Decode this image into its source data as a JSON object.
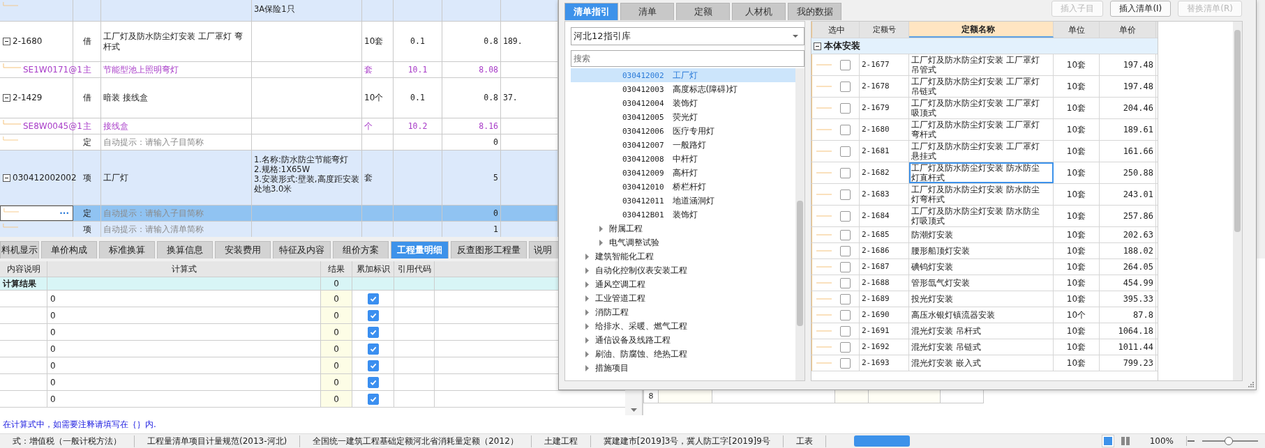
{
  "top_table": {
    "rows": [
      {
        "kind": "item",
        "selected": false,
        "features": "3A保险1只"
      },
      {
        "kind": "quota",
        "selected": false,
        "expanded": true,
        "code": "2-1680",
        "type": "借",
        "name": "工厂灯及防水防尘灯安装 工厂罩灯 弯杆式",
        "unit": "10套",
        "col_6": "0.1",
        "col_7": "0.8",
        "col_8": "189."
      },
      {
        "kind": "material",
        "selected": false,
        "code": "SE1W0171@1",
        "type": "主",
        "name": "节能型池上照明弯灯",
        "unit": "套",
        "col_6": "10.1",
        "col_7": "8.08"
      },
      {
        "kind": "quota",
        "selected": false,
        "expanded": true,
        "code": "2-1429",
        "type": "借",
        "name": "暗装 接线盒",
        "unit": "10个",
        "col_6": "0.1",
        "col_7": "0.8",
        "col_8": "37."
      },
      {
        "kind": "material",
        "selected": false,
        "code": "SE8W0045@1",
        "type": "主",
        "name": "接线盒",
        "unit": "个",
        "col_6": "10.2",
        "col_7": "8.16"
      },
      {
        "kind": "placeholder",
        "selected": false,
        "type": "定",
        "name": "自动提示：请输入子目简称",
        "col_7": "0"
      },
      {
        "kind": "item",
        "selected": false,
        "expanded": true,
        "code": "030412002002",
        "type": "项",
        "name": "工厂灯",
        "features": "1.名称:防水防尘节能弯灯\n2.规格:1X65W\n3.安装形式:壁装,高度距安装处地3.0米",
        "unit": "套",
        "col_7": "5"
      },
      {
        "kind": "placeholder",
        "selected": true,
        "edit_button": "···",
        "type": "定",
        "name": "自动提示：请输入子目简称",
        "col_7": "0"
      },
      {
        "kind": "item-placeholder",
        "selected": false,
        "type": "项",
        "name": "自动提示：请输入清单简称",
        "col_7": "1"
      }
    ]
  },
  "detail_tabs": [
    {
      "label": "料机显示",
      "selected": false
    },
    {
      "label": "单价构成",
      "selected": false
    },
    {
      "label": "标准换算",
      "selected": false
    },
    {
      "label": "换算信息",
      "selected": false
    },
    {
      "label": "安装费用",
      "selected": false
    },
    {
      "label": "特征及内容",
      "selected": false
    },
    {
      "label": "组价方案",
      "selected": false
    },
    {
      "label": "工程量明细",
      "selected": true
    },
    {
      "label": "反查图形工程量",
      "selected": false
    },
    {
      "label": "说明",
      "selected": false
    }
  ],
  "detail_table": {
    "columns": [
      "内容说明",
      "计算式",
      "结果",
      "累加标识",
      "引用代码"
    ],
    "total_row": {
      "label": "计算结果",
      "result": "0"
    },
    "rows": [
      {
        "formula": "0",
        "result": "0",
        "checked": true
      },
      {
        "formula": "0",
        "result": "0",
        "checked": true
      },
      {
        "formula": "0",
        "result": "0",
        "checked": true
      },
      {
        "formula": "0",
        "result": "0",
        "checked": true
      },
      {
        "formula": "0",
        "result": "0",
        "checked": true
      },
      {
        "formula": "0",
        "result": "0",
        "checked": true
      },
      {
        "formula": "0",
        "result": "0",
        "checked": true
      }
    ]
  },
  "side_table": {
    "row_number": "8"
  },
  "note": "在计算式中，如需要注释请填写在｛｝内.",
  "status_bar": {
    "items": [
      "式：增值税（一般计税方法）",
      "工程量清单项目计量规范(2013-河北)",
      "全国统一建筑工程基础定额河北省消耗量定额（2012）",
      "土建工程",
      "冀建建市[2019]3号，冀人防工字[2019]9号",
      "工表"
    ],
    "zoom": "100%",
    "zoom_slider": {
      "level": 0.45
    }
  },
  "dialog": {
    "tabs": [
      {
        "label": "清单指引",
        "selected": true
      },
      {
        "label": "清单",
        "selected": false
      },
      {
        "label": "定额",
        "selected": false
      },
      {
        "label": "人材机",
        "selected": false
      },
      {
        "label": "我的数据",
        "selected": false
      }
    ],
    "buttons": [
      {
        "label": "插入子目",
        "disabled": true
      },
      {
        "label": "插入清单(I)",
        "disabled": false
      },
      {
        "label": "替换清单(R)",
        "disabled": true
      }
    ],
    "library": "河北12指引库",
    "search": {
      "placeholder": "搜索"
    },
    "tree": [
      {
        "children": [
          {
            "children": [
              {
                "code": "030412002",
                "name": "工厂灯",
                "selected": true
              },
              {
                "code": "030412003",
                "name": "高度标志(障碍)灯",
                "selected": false
              },
              {
                "code": "030412004",
                "name": "装饰灯",
                "selected": false
              },
              {
                "code": "030412005",
                "name": "荧光灯",
                "selected": false
              },
              {
                "code": "030412006",
                "name": "医疗专用灯",
                "selected": false
              },
              {
                "code": "030412007",
                "name": "一般路灯",
                "selected": false
              },
              {
                "code": "030412008",
                "name": "中杆灯",
                "selected": false
              },
              {
                "code": "030412009",
                "name": "高杆灯",
                "selected": false
              },
              {
                "code": "030412010",
                "name": "桥栏杆灯",
                "selected": false
              },
              {
                "code": "030412011",
                "name": "地道涵洞灯",
                "selected": false
              },
              {
                "code": "030412B01",
                "name": "装饰灯",
                "selected": false
              }
            ]
          },
          {
            "label": "附属工程",
            "expanded": false
          },
          {
            "label": "电气调整试验",
            "expanded": false
          }
        ]
      },
      {
        "label": "建筑智能化工程",
        "expanded": false
      },
      {
        "label": "自动化控制仪表安装工程",
        "expanded": false
      },
      {
        "label": "通风空调工程",
        "expanded": false
      },
      {
        "label": "工业管道工程",
        "expanded": false
      },
      {
        "label": "消防工程",
        "expanded": false
      },
      {
        "label": "给排水、采暖、燃气工程",
        "expanded": false
      },
      {
        "label": "通信设备及线路工程",
        "expanded": false
      },
      {
        "label": "刷油、防腐蚀、绝热工程",
        "expanded": false
      },
      {
        "label": "措施项目",
        "expanded": false
      }
    ],
    "quota_table": {
      "columns": [
        "选中",
        "定额号",
        "定额名称",
        "单位",
        "单价"
      ],
      "group": {
        "label": "本体安装",
        "expanded": true
      },
      "rows": [
        {
          "checked": false,
          "selected": false,
          "code": "2-1677",
          "name": "工厂灯及防水防尘灯安装 工厂罩灯吊管式",
          "unit": "10套",
          "price": "197.48"
        },
        {
          "checked": false,
          "selected": false,
          "code": "2-1678",
          "name": "工厂灯及防水防尘灯安装 工厂罩灯吊链式",
          "unit": "10套",
          "price": "197.48"
        },
        {
          "checked": false,
          "selected": false,
          "code": "2-1679",
          "name": "工厂灯及防水防尘灯安装 工厂罩灯吸顶式",
          "unit": "10套",
          "price": "204.46"
        },
        {
          "checked": false,
          "selected": false,
          "code": "2-1680",
          "name": "工厂灯及防水防尘灯安装 工厂罩灯弯杆式",
          "unit": "10套",
          "price": "189.61"
        },
        {
          "checked": false,
          "selected": false,
          "code": "2-1681",
          "name": "工厂灯及防水防尘灯安装 工厂罩灯悬挂式",
          "unit": "10套",
          "price": "161.66"
        },
        {
          "checked": false,
          "selected": true,
          "code": "2-1682",
          "name": "工厂灯及防水防尘灯安装 防水防尘灯直杆式",
          "unit": "10套",
          "price": "250.88"
        },
        {
          "checked": false,
          "selected": false,
          "code": "2-1683",
          "name": "工厂灯及防水防尘灯安装 防水防尘灯弯杆式",
          "unit": "10套",
          "price": "243.01"
        },
        {
          "checked": false,
          "selected": false,
          "code": "2-1684",
          "name": "工厂灯及防水防尘灯安装 防水防尘灯吸顶式",
          "unit": "10套",
          "price": "257.86"
        },
        {
          "checked": false,
          "selected": false,
          "code": "2-1685",
          "name": "防潮灯安装",
          "unit": "10套",
          "price": "202.63"
        },
        {
          "checked": false,
          "selected": false,
          "code": "2-1686",
          "name": "腰形船顶灯安装",
          "unit": "10套",
          "price": "188.02"
        },
        {
          "checked": false,
          "selected": false,
          "code": "2-1687",
          "name": "碘钨灯安装",
          "unit": "10套",
          "price": "264.05"
        },
        {
          "checked": false,
          "selected": false,
          "code": "2-1688",
          "name": "管形氙气灯安装",
          "unit": "10套",
          "price": "454.99"
        },
        {
          "checked": false,
          "selected": false,
          "code": "2-1689",
          "name": "投光灯安装",
          "unit": "10套",
          "price": "395.33"
        },
        {
          "checked": false,
          "selected": false,
          "code": "2-1690",
          "name": "高压水银灯镇流器安装",
          "unit": "10个",
          "price": "87.8"
        },
        {
          "checked": false,
          "selected": false,
          "code": "2-1691",
          "name": "混光灯安装 吊杆式",
          "unit": "10套",
          "price": "1064.18"
        },
        {
          "checked": false,
          "selected": false,
          "code": "2-1692",
          "name": "混光灯安装 吊链式",
          "unit": "10套",
          "price": "1011.44"
        },
        {
          "checked": false,
          "selected": false,
          "code": "2-1693",
          "name": "混光灯安装 嵌入式",
          "unit": "10套",
          "price": "799.23"
        }
      ]
    }
  }
}
